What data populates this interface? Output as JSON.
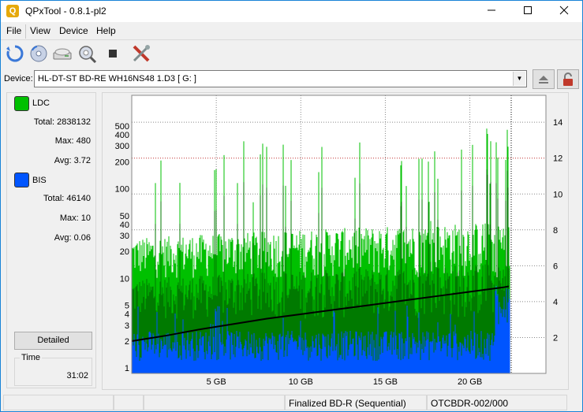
{
  "window": {
    "title": "QPxTool - 0.8.1-pl2",
    "app_icon_letter": "Q",
    "controls": [
      "minimize-icon",
      "maximize-icon",
      "close-icon"
    ]
  },
  "menu": {
    "file": "File",
    "view": "View",
    "device": "Device",
    "help": "Help"
  },
  "toolbar": {
    "icons": [
      "refresh-icon",
      "disc-scan-icon",
      "drive-info-icon",
      "search-disc-icon",
      "stop-icon",
      "settings-tools-icon"
    ]
  },
  "device": {
    "label": "Device:",
    "value": "HL-DT-ST BD-RE  WH16NS48  1.D3 [ G: ]",
    "buttons": [
      "eject-icon",
      "lock-icon"
    ]
  },
  "legend": {
    "ldc": {
      "name": "LDC",
      "color": "#00c000",
      "total_label": "Total:",
      "total": "2838132",
      "max_label": "Max:",
      "max": "480",
      "avg_label": "Avg:",
      "avg": "3.72"
    },
    "bis": {
      "name": "BIS",
      "color": "#0055ff",
      "total_label": "Total:",
      "total": "46140",
      "max_label": "Max:",
      "max": "10",
      "avg_label": "Avg:",
      "avg": "0.06"
    }
  },
  "detailed_button": "Detailed",
  "time": {
    "label": "Time",
    "value": "31:02"
  },
  "status": {
    "cell1": "",
    "cell2": "",
    "disc_type": "Finalized BD-R (Sequential)",
    "media_id": "OTCBDR-002/000"
  },
  "chart_data": {
    "type": "area",
    "x_unit": "GB",
    "x_ticks": [
      "5 GB",
      "10 GB",
      "15 GB",
      "20 GB"
    ],
    "x_tick_values": [
      5,
      10,
      15,
      20
    ],
    "xlim": [
      0,
      24.5
    ],
    "y_left_scale": "log",
    "y_left_ticks": [
      "1",
      "2",
      "3",
      "4",
      "5",
      "10",
      "20",
      "30",
      "40",
      "50",
      "100",
      "200",
      "300",
      "400",
      "500"
    ],
    "y_left_tick_values": [
      1,
      2,
      3,
      4,
      5,
      10,
      20,
      30,
      40,
      50,
      100,
      200,
      300,
      400,
      500
    ],
    "y_right_ticks": [
      "2",
      "4",
      "6",
      "8",
      "10",
      "12",
      "14"
    ],
    "y_right_tick_values": [
      2,
      4,
      6,
      8,
      10,
      12,
      14
    ],
    "y_right_lim": [
      0,
      15.5
    ],
    "grid": true,
    "series": [
      {
        "name": "LDC",
        "color": "#00c000"
      },
      {
        "name": "BIS",
        "color": "#0055ff"
      }
    ],
    "speed_curve": {
      "color": "#000000",
      "x": [
        0,
        2,
        4,
        6,
        8,
        10,
        12,
        14,
        16,
        18,
        20,
        22,
        22.3
      ],
      "y": [
        1.8,
        2.1,
        2.45,
        2.75,
        3.05,
        3.3,
        3.55,
        3.8,
        4.05,
        4.3,
        4.55,
        4.8,
        4.85
      ]
    },
    "ldc_max_value": 480,
    "ldc_typical_range": [
      10,
      40
    ],
    "bis_typical_range": [
      1,
      3
    ],
    "data_end_gb": 22.4
  }
}
